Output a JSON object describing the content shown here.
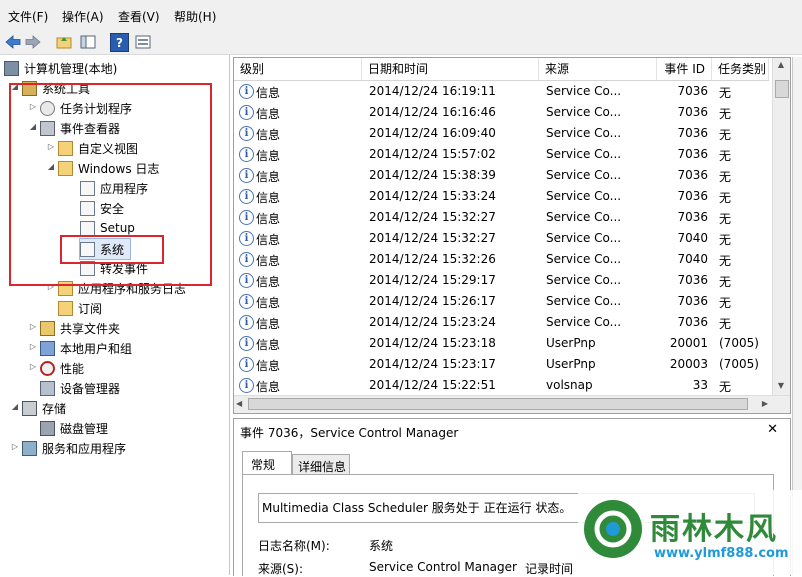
{
  "menu": [
    "文件(F)",
    "操作(A)",
    "查看(V)",
    "帮助(H)"
  ],
  "toolbar": {
    "icons": [
      "back-arrow-icon",
      "forward-arrow-icon",
      "up-folder-icon",
      "show-hide-tree-icon",
      "help-icon",
      "properties-icon"
    ],
    "help_glyph": "?"
  },
  "tree": {
    "root": "计算机管理(本地)",
    "system_tools": "系统工具",
    "task_scheduler": "任务计划程序",
    "event_viewer": "事件查看器",
    "custom_views": "自定义视图",
    "windows_logs": "Windows 日志",
    "application": "应用程序",
    "security": "安全",
    "setup": "Setup",
    "system": "系统",
    "forwarded": "转发事件",
    "app_service_logs": "应用程序和服务日志",
    "subscriptions": "订阅",
    "shared_folders": "共享文件夹",
    "local_users": "本地用户和组",
    "performance": "性能",
    "device_manager": "设备管理器",
    "storage": "存储",
    "disk_management": "磁盘管理",
    "services_apps": "服务和应用程序"
  },
  "events": {
    "columns": [
      "级别",
      "日期和时间",
      "来源",
      "事件 ID",
      "任务类别"
    ],
    "rows": [
      {
        "level": "信息",
        "datetime": "2014/12/24 16:19:11",
        "source": "Service Co...",
        "id": "7036",
        "category": "无"
      },
      {
        "level": "信息",
        "datetime": "2014/12/24 16:16:46",
        "source": "Service Co...",
        "id": "7036",
        "category": "无"
      },
      {
        "level": "信息",
        "datetime": "2014/12/24 16:09:40",
        "source": "Service Co...",
        "id": "7036",
        "category": "无"
      },
      {
        "level": "信息",
        "datetime": "2014/12/24 15:57:02",
        "source": "Service Co...",
        "id": "7036",
        "category": "无"
      },
      {
        "level": "信息",
        "datetime": "2014/12/24 15:38:39",
        "source": "Service Co...",
        "id": "7036",
        "category": "无"
      },
      {
        "level": "信息",
        "datetime": "2014/12/24 15:33:24",
        "source": "Service Co...",
        "id": "7036",
        "category": "无"
      },
      {
        "level": "信息",
        "datetime": "2014/12/24 15:32:27",
        "source": "Service Co...",
        "id": "7036",
        "category": "无"
      },
      {
        "level": "信息",
        "datetime": "2014/12/24 15:32:27",
        "source": "Service Co...",
        "id": "7040",
        "category": "无"
      },
      {
        "level": "信息",
        "datetime": "2014/12/24 15:32:26",
        "source": "Service Co...",
        "id": "7040",
        "category": "无"
      },
      {
        "level": "信息",
        "datetime": "2014/12/24 15:29:17",
        "source": "Service Co...",
        "id": "7036",
        "category": "无"
      },
      {
        "level": "信息",
        "datetime": "2014/12/24 15:26:17",
        "source": "Service Co...",
        "id": "7036",
        "category": "无"
      },
      {
        "level": "信息",
        "datetime": "2014/12/24 15:23:24",
        "source": "Service Co...",
        "id": "7036",
        "category": "无"
      },
      {
        "level": "信息",
        "datetime": "2014/12/24 15:23:18",
        "source": "UserPnp",
        "id": "20001",
        "category": "(7005)"
      },
      {
        "level": "信息",
        "datetime": "2014/12/24 15:23:17",
        "source": "UserPnp",
        "id": "20003",
        "category": "(7005)"
      },
      {
        "level": "信息",
        "datetime": "2014/12/24 15:22:51",
        "source": "volsnap",
        "id": "33",
        "category": "无"
      }
    ]
  },
  "detail": {
    "title": "事件 7036，Service Control Manager",
    "close_glyph": "✕",
    "tabs": [
      "常规",
      "详细信息"
    ],
    "message": "Multimedia Class Scheduler 服务处于 正在运行 状态。",
    "log_name_label": "日志名称(M):",
    "log_name_value": "系统",
    "source_label": "来源(S):",
    "source_value": "Service Control Manager",
    "logged_label": "记录时间"
  },
  "watermark": {
    "brand": "雨林木风",
    "url": "www.ylmf888.com"
  },
  "colors": {
    "highlight_box": "#d9282d",
    "watermark_green": "#2f8a3a"
  }
}
